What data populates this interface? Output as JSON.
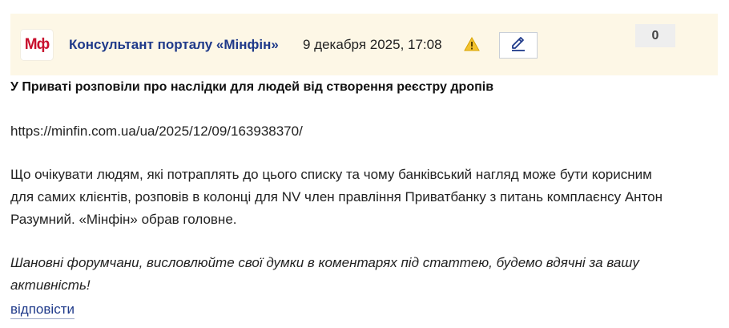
{
  "comment": {
    "logo_text": "Мф",
    "author": "Консультант порталу «Мінфін»",
    "date": "9 декабря 2025, 17:08",
    "warning_icon": "warning-icon",
    "edit_icon": "pencil-icon",
    "vote_count": "0",
    "title": "У Приваті розповіли про наслідки для людей від створення реєстру дропів",
    "url": "https://minfin.com.ua/ua/2025/12/09/163938370/",
    "body_lines": [
      "Що очікувати людям, які потраплять до цього списку та чому банківський нагляд може бути корисним",
      "для самих клієнтів, розповів в колонці для NV член правління Приватбанку з питань комплаєнсу Антон",
      "Разумний. «Мінфін» обрав головне."
    ],
    "call_to_action_lines": [
      "Шановні форумчани, висловлюйте свої думки в коментарях під статтею, будемо вдячні за вашу",
      "активність!"
    ],
    "reply_label": "відповісти"
  },
  "colors": {
    "header_bg": "#fdf7e6",
    "brand_red": "#c8102e",
    "link_blue": "#1f3a8a",
    "warning_yellow": "#f2c230"
  }
}
